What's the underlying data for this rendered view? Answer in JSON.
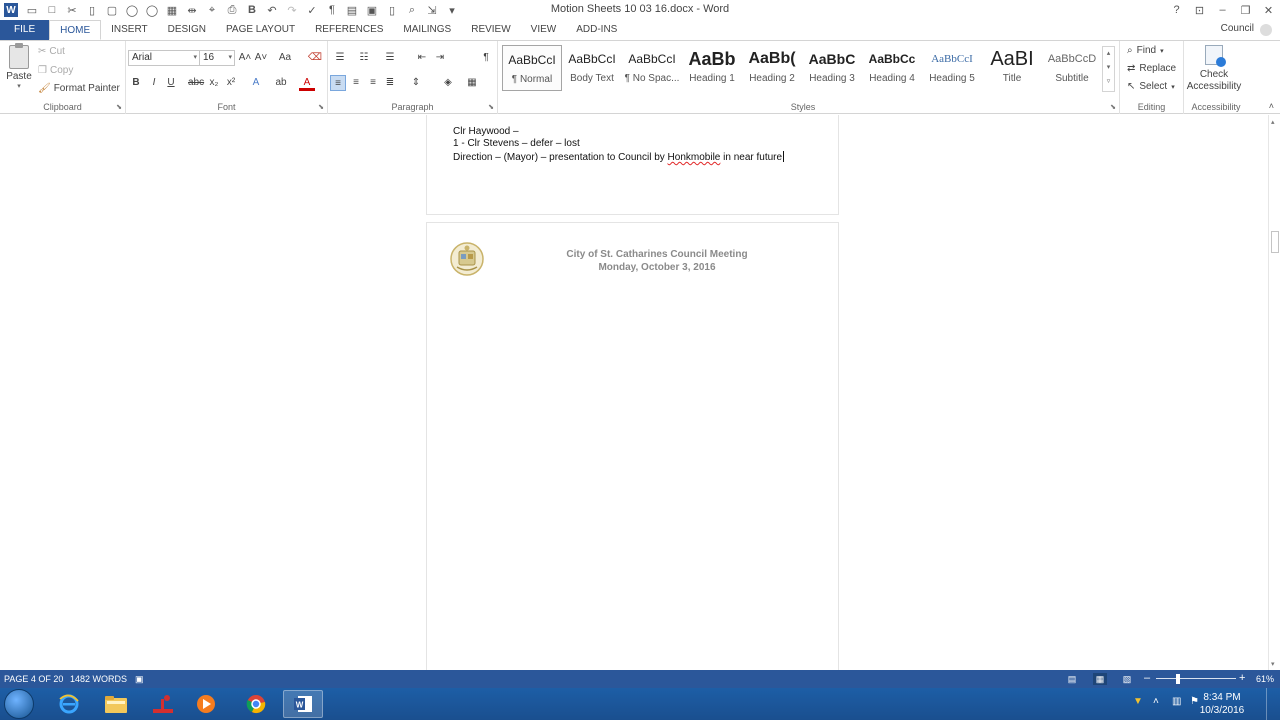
{
  "window": {
    "title": "Motion Sheets 10 03 16.docx - Word",
    "account": "Council"
  },
  "tabs": [
    "FILE",
    "HOME",
    "INSERT",
    "DESIGN",
    "PAGE LAYOUT",
    "REFERENCES",
    "MAILINGS",
    "REVIEW",
    "VIEW",
    "ADD-INS"
  ],
  "ribbon": {
    "clipboard": {
      "paste": "Paste",
      "cut": "Cut",
      "copy": "Copy",
      "format_painter": "Format Painter",
      "label": "Clipboard"
    },
    "font": {
      "name": "Arial",
      "size": "16",
      "label": "Font"
    },
    "paragraph": {
      "label": "Paragraph"
    },
    "styles": {
      "label": "Styles",
      "items": [
        {
          "preview": "AaBbCcI",
          "name": "¶ Normal"
        },
        {
          "preview": "AaBbCcI",
          "name": "Body Text"
        },
        {
          "preview": "AaBbCcI",
          "name": "¶ No Spac..."
        },
        {
          "preview": "AaBb",
          "name": "Heading 1"
        },
        {
          "preview": "AaBb(",
          "name": "Heading 2"
        },
        {
          "preview": "AaBbC",
          "name": "Heading 3"
        },
        {
          "preview": "AaBbCc",
          "name": "Heading 4"
        },
        {
          "preview": "AaBbCcI",
          "name": "Heading 5"
        },
        {
          "preview": "AaBI",
          "name": "Title"
        },
        {
          "preview": "AaBbCcD",
          "name": "Subtitle"
        }
      ]
    },
    "editing": {
      "find": "Find",
      "replace": "Replace",
      "select": "Select",
      "label": "Editing"
    },
    "accessibility": {
      "check_line1": "Check",
      "check_line2": "Accessibility",
      "label": "Accessibility"
    }
  },
  "document": {
    "lines": [
      "Clr Haywood –",
      "1 - Clr Stevens – defer – lost"
    ],
    "direction_prefix": "Direction – (Mayor) – presentation to Council by ",
    "direction_misspelled": "Honkmobile",
    "direction_suffix": " in near future",
    "header_line1": "City of St. Catharines Council Meeting",
    "header_line2": "Monday, October 3, 2016"
  },
  "status": {
    "page": "PAGE 4 OF 20",
    "words": "1482 WORDS",
    "zoom": "61%"
  },
  "clock": {
    "time": "8:34 PM",
    "date": "10/3/2016"
  },
  "colors": {
    "accent": "#2b579a",
    "taskbar": "#1d5ea6"
  }
}
